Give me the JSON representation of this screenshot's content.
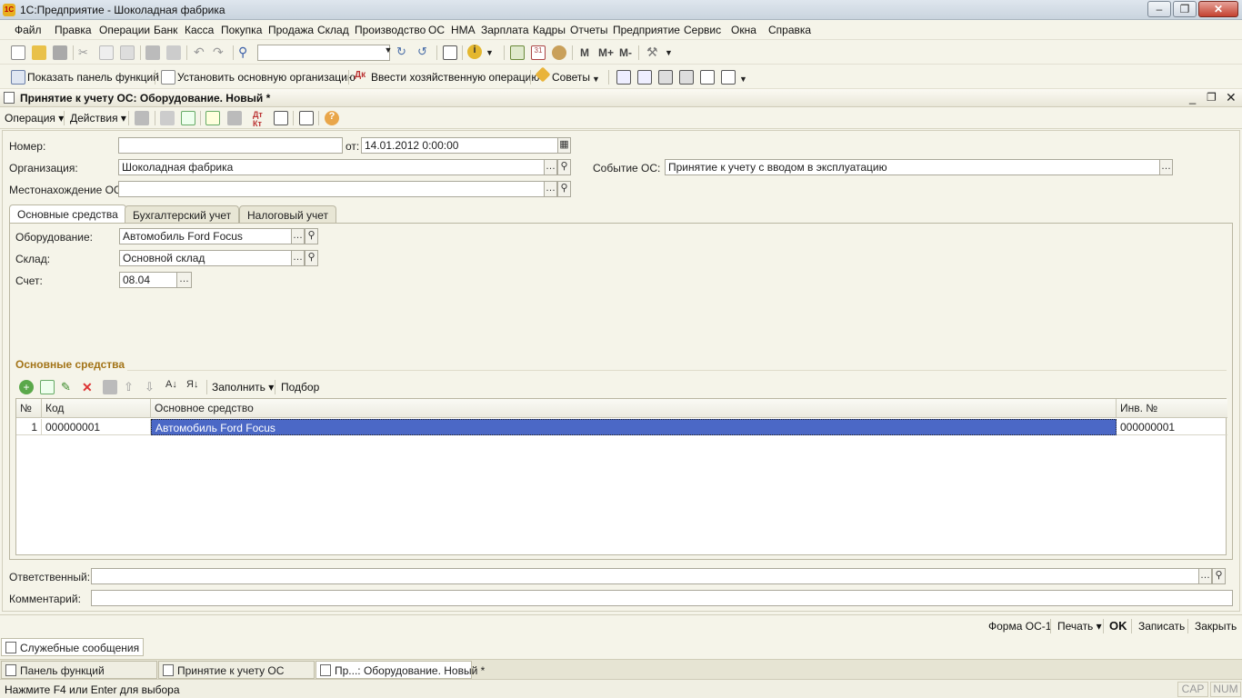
{
  "window": {
    "title": "1С:Предприятие - Шоколадная фабрика",
    "app_icon": "1C"
  },
  "menu": [
    "Файл",
    "Правка",
    "Операции",
    "Банк",
    "Касса",
    "Покупка",
    "Продажа",
    "Склад",
    "Производство",
    "ОС",
    "НМА",
    "Зарплата",
    "Кадры",
    "Отчеты",
    "Предприятие",
    "Сервис",
    "Окна",
    "Справка"
  ],
  "toolbar1": {
    "m": "M",
    "mplus": "M+",
    "mminus": "M-"
  },
  "toolbar2": {
    "show_panel": "Показать панель функций",
    "set_org": "Установить основную организацию",
    "enter_op": "Ввести хозяйственную операцию",
    "tips": "Советы"
  },
  "document": {
    "title": "Принятие к учету ОС: Оборудование. Новый *",
    "operation_menu": "Операция",
    "actions_menu": "Действия",
    "number_label": "Номер:",
    "number_value": "",
    "from_label": "от:",
    "date_value": "14.01.2012  0:00:00",
    "org_label": "Организация:",
    "org_value": "Шоколадная фабрика",
    "event_label": "Событие ОС:",
    "event_value": "Принятие к учету с вводом в эксплуатацию",
    "location_label": "Местонахождение ОС:",
    "location_value": ""
  },
  "tabs": [
    "Основные средства",
    "Бухгалтерский учет",
    "Налоговый учет"
  ],
  "tab_main": {
    "equipment_label": "Оборудование:",
    "equipment_value": "Автомобиль Ford Focus",
    "warehouse_label": "Склад:",
    "warehouse_value": "Основной склад",
    "account_label": "Счет:",
    "account_value": "08.04",
    "section_title": "Основные средства",
    "fill_button": "Заполнить",
    "select_button": "Подбор"
  },
  "grid": {
    "columns": [
      "№",
      "Код",
      "Основное средство",
      "Инв. №"
    ],
    "rows": [
      {
        "num": "1",
        "code": "000000001",
        "asset": "Автомобиль Ford Focus",
        "inv": "000000001"
      }
    ]
  },
  "footer": {
    "responsible_label": "Ответственный:",
    "responsible_value": "",
    "comment_label": "Комментарий:",
    "comment_value": ""
  },
  "commands": {
    "form": "Форма ОС-1",
    "print": "Печать",
    "ok": "OK",
    "save": "Записать",
    "close": "Закрыть"
  },
  "service_messages": "Служебные сообщения",
  "tasks": [
    "Панель функций",
    "Принятие к учету ОС",
    "Пр...: Оборудование. Новый *"
  ],
  "status": {
    "hint": "Нажмите F4 или Enter для выбора",
    "cap": "CAP",
    "num": "NUM"
  }
}
